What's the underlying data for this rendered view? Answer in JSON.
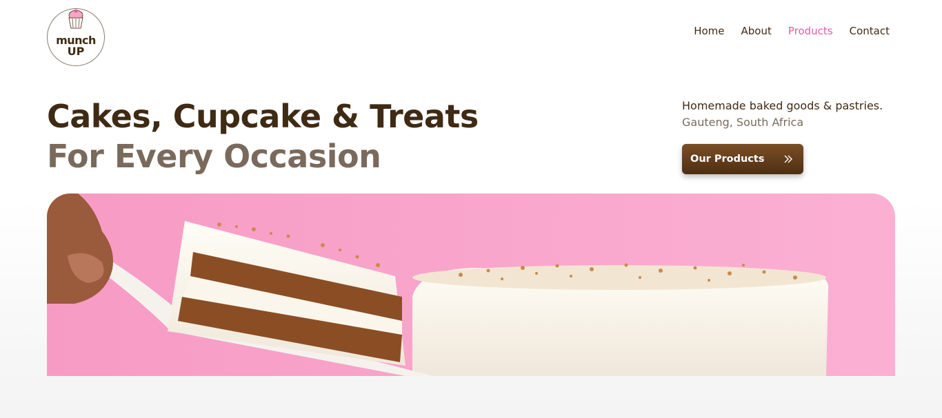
{
  "brand": {
    "line1": "munch",
    "line2": "UP"
  },
  "nav": {
    "home": "Home",
    "about": "About",
    "products": "Products",
    "contact": "Contact"
  },
  "hero": {
    "title_line1": "Cakes, Cupcake & Treats",
    "title_line2": "For Every Occasion",
    "tagline": "Homemade baked goods & pastries.",
    "location": "Gauteng, South Africa",
    "cta_label": "Our Products",
    "cta_icon": "double-chevron-right-icon",
    "image": "carrot-cake-slice-on-pink"
  },
  "colors": {
    "brand_brown": "#3f2a14",
    "muted_brown": "#7a6a5c",
    "accent_pink": "#e05d9c",
    "hero_background": "#f9a6cc"
  }
}
